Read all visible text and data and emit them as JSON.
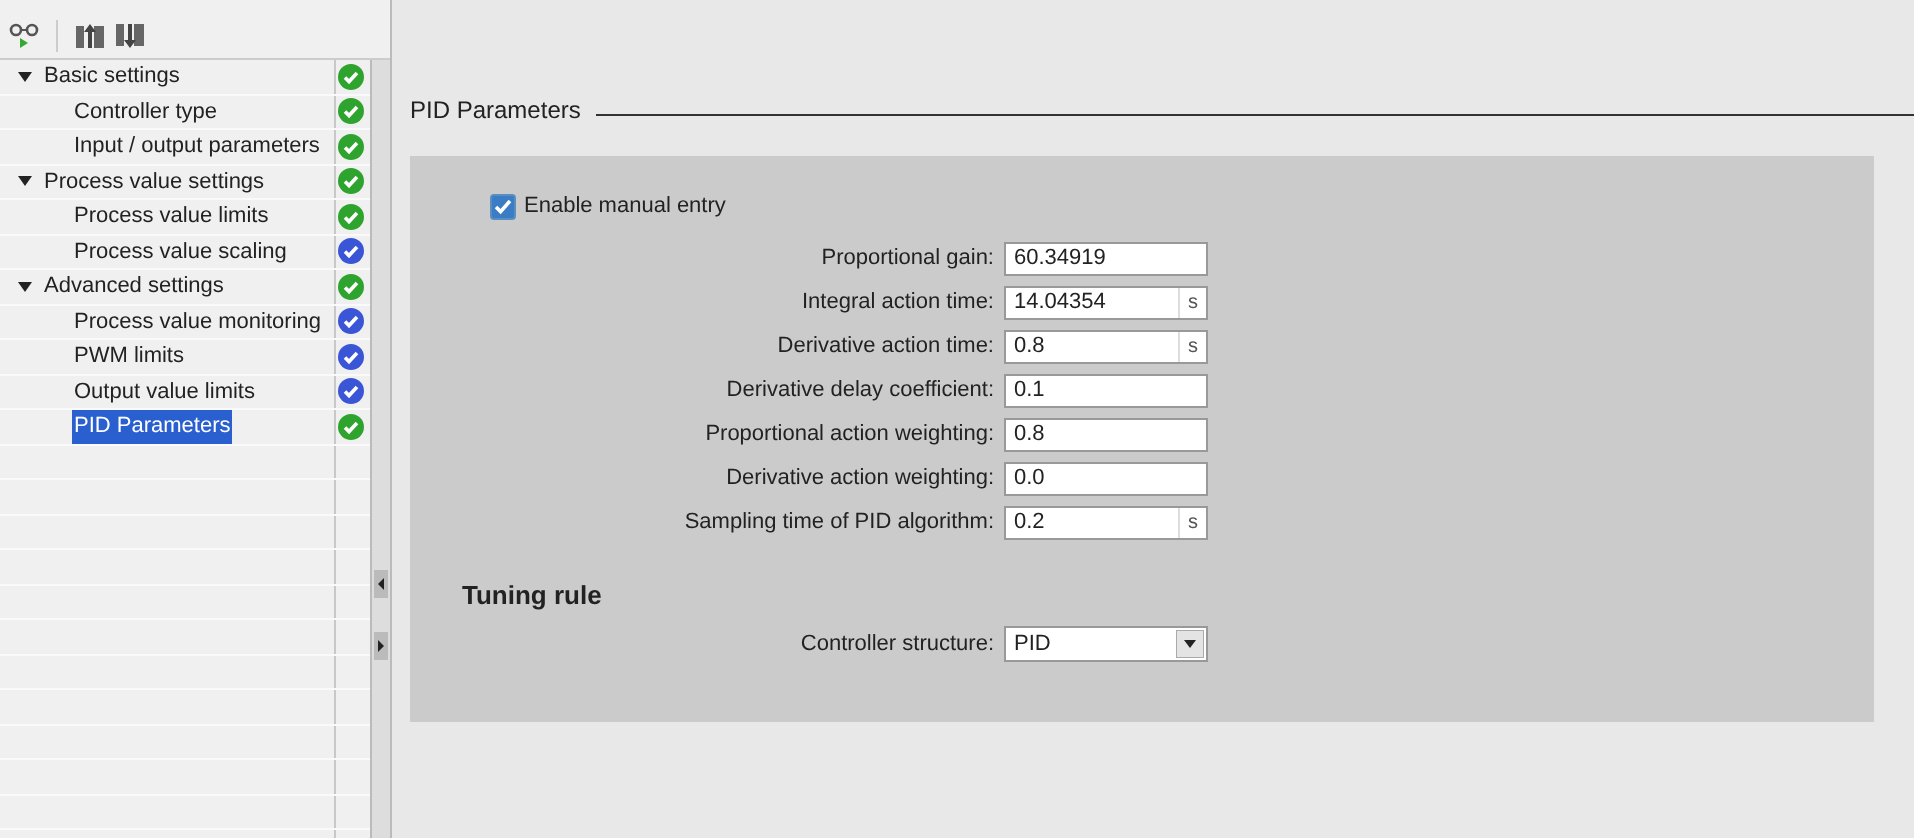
{
  "tree": [
    {
      "label": "Basic settings",
      "color": "#2ea32e",
      "expanded": true,
      "children": [
        {
          "label": "Controller type",
          "color": "#2ea32e",
          "selected": false
        },
        {
          "label": "Input / output parameters",
          "color": "#2ea32e",
          "selected": false
        }
      ]
    },
    {
      "label": "Process value settings",
      "color": "#2ea32e",
      "expanded": true,
      "children": [
        {
          "label": "Process value limits",
          "color": "#2ea32e",
          "selected": false
        },
        {
          "label": "Process value scaling",
          "color": "#3a55d6",
          "selected": false
        }
      ]
    },
    {
      "label": "Advanced settings",
      "color": "#2ea32e",
      "expanded": true,
      "children": [
        {
          "label": "Process value monitoring",
          "color": "#3a55d6",
          "selected": false
        },
        {
          "label": "PWM limits",
          "color": "#3a55d6",
          "selected": false
        },
        {
          "label": "Output value limits",
          "color": "#3a55d6",
          "selected": false
        },
        {
          "label": "PID Parameters",
          "color": "#2ea32e",
          "selected": true
        }
      ]
    }
  ],
  "section_title": "PID Parameters",
  "manual_entry": {
    "label": "Enable manual entry",
    "checked": true
  },
  "parameters": [
    {
      "label": "Proportional gain:",
      "value": "60.34919"
    },
    {
      "label": "Integral action time:",
      "value": "14.04354",
      "unit": "s"
    },
    {
      "label": "Derivative action time:",
      "value": "0.8",
      "unit": "s"
    },
    {
      "label": "Derivative delay coefficient:",
      "value": "0.1"
    },
    {
      "label": "Proportional action weighting:",
      "value": "0.8"
    },
    {
      "label": "Derivative action weighting:",
      "value": "0.0"
    },
    {
      "label": "Sampling time of PID algorithm:",
      "value": "0.2",
      "unit": "s"
    }
  ],
  "tuning_rule": {
    "title": "Tuning rule",
    "label": "Controller structure:",
    "value": "PID"
  }
}
